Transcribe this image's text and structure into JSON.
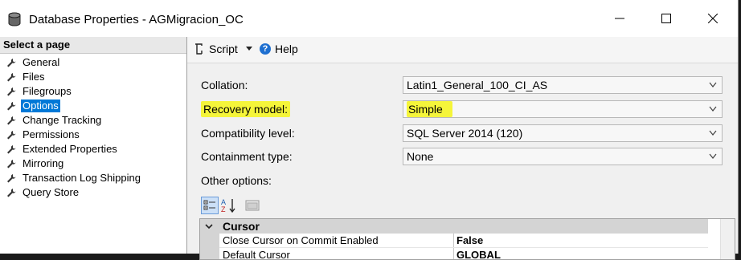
{
  "window": {
    "title": "Database Properties - AGMigracion_OC"
  },
  "left_pane": {
    "header": "Select a page",
    "items": [
      {
        "label": "General"
      },
      {
        "label": "Files"
      },
      {
        "label": "Filegroups"
      },
      {
        "label": "Options",
        "selected": true
      },
      {
        "label": "Change Tracking"
      },
      {
        "label": "Permissions"
      },
      {
        "label": "Extended Properties"
      },
      {
        "label": "Mirroring"
      },
      {
        "label": "Transaction Log Shipping"
      },
      {
        "label": "Query Store"
      }
    ]
  },
  "toolbar": {
    "script_label": "Script",
    "help_label": "Help"
  },
  "options": {
    "collation": {
      "label": "Collation:",
      "value": "Latin1_General_100_CI_AS"
    },
    "recovery_model": {
      "label": "Recovery model:",
      "value": "Simple"
    },
    "compatibility_level": {
      "label": "Compatibility level:",
      "value": "SQL Server 2014 (120)"
    },
    "containment_type": {
      "label": "Containment type:",
      "value": "None"
    },
    "other_options_label": "Other options:"
  },
  "grid": {
    "category": "Cursor",
    "rows": [
      {
        "name": "Close Cursor on Commit Enabled",
        "value": "False"
      },
      {
        "name": "Default Cursor",
        "value": "GLOBAL"
      }
    ]
  },
  "colors": {
    "highlight": "#f5f53a",
    "selection": "#0078d7"
  }
}
